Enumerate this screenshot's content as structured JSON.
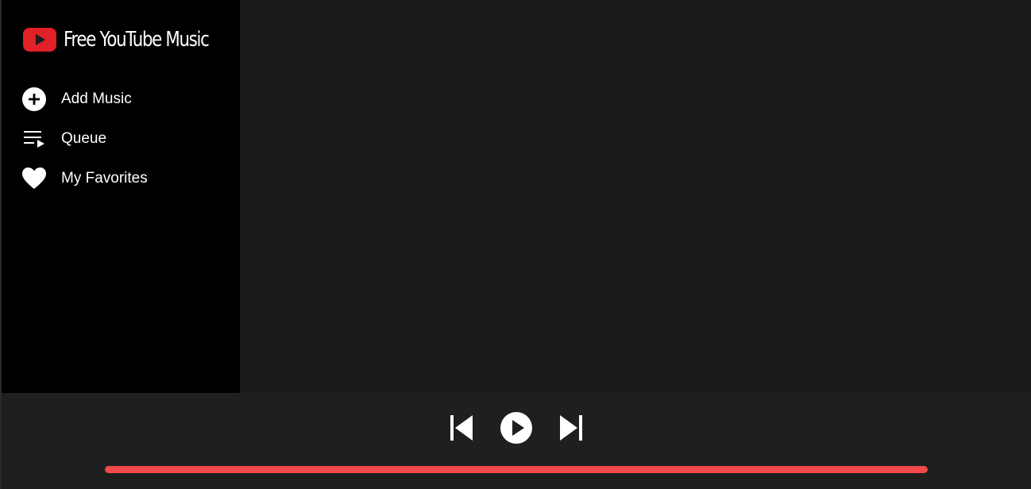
{
  "brand": {
    "title": "Free YouTube Music",
    "logo_icon": "youtube-play-icon",
    "logo_color": "#e22027"
  },
  "sidebar": {
    "items": [
      {
        "label": "Add Music",
        "icon": "add-circle-icon"
      },
      {
        "label": "Queue",
        "icon": "queue-list-icon"
      },
      {
        "label": "My Favorites",
        "icon": "heart-icon"
      }
    ]
  },
  "player": {
    "controls": {
      "previous_icon": "skip-previous-icon",
      "play_icon": "play-circle-icon",
      "next_icon": "skip-next-icon"
    },
    "progress": 1.0,
    "progress_color": "#f04a4a"
  },
  "colors": {
    "sidebar_bg": "#000000",
    "main_bg": "#1b1b1b",
    "player_bg": "#1f1f1f",
    "text": "#ffffff"
  }
}
